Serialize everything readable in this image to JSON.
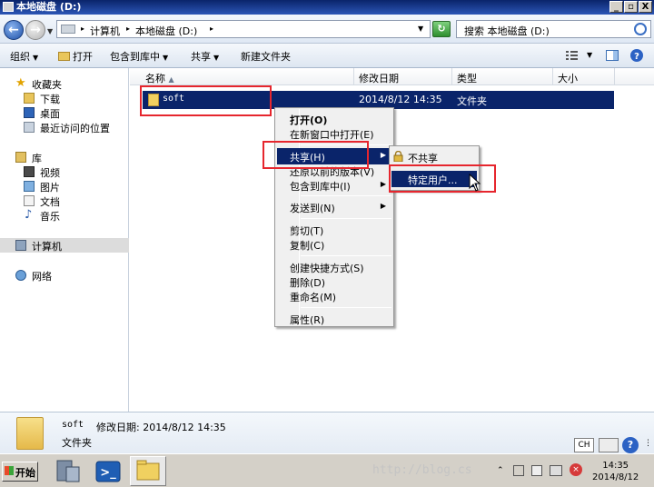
{
  "window": {
    "title": "本地磁盘 (D:)",
    "min_glyph": "_",
    "max_glyph": "▫",
    "close_glyph": "X"
  },
  "address": {
    "crumbs": [
      "计算机",
      "本地磁盘 (D:)"
    ],
    "search_placeholder": "搜索 本地磁盘 (D:)"
  },
  "toolbar": {
    "organize": "组织",
    "open": "打开",
    "include": "包含到库中",
    "share": "共享",
    "new_folder": "新建文件夹"
  },
  "nav": {
    "favorites": "收藏夹",
    "downloads": "下载",
    "desktop": "桌面",
    "recent": "最近访问的位置",
    "libraries": "库",
    "videos": "视频",
    "pictures": "图片",
    "documents": "文档",
    "music": "音乐",
    "computer": "计算机",
    "network": "网络"
  },
  "columns": {
    "name": "名称",
    "modified": "修改日期",
    "type": "类型",
    "size": "大小"
  },
  "files": [
    {
      "name": "soft",
      "modified": "2014/8/12 14:35",
      "type": "文件夹",
      "size": ""
    }
  ],
  "context_menu": {
    "open": "打开(O)",
    "open_new_window": "在新窗口中打开(E)",
    "share": "共享(H)",
    "restore": "还原以前的版本(V)",
    "include": "包含到库中(I)",
    "send_to": "发送到(N)",
    "cut": "剪切(T)",
    "copy": "复制(C)",
    "shortcut": "创建快捷方式(S)",
    "delete": "删除(D)",
    "rename": "重命名(M)",
    "properties": "属性(R)"
  },
  "share_submenu": {
    "no_share": "不共享",
    "specific_users": "特定用户..."
  },
  "details": {
    "name": "soft",
    "modified": "修改日期: 2014/8/12 14:35",
    "type": "文件夹"
  },
  "taskbar": {
    "start": "开始",
    "ime": "CH",
    "watermark": "http://blog.cs",
    "time": "14:35",
    "date": "2014/8/12"
  },
  "colors": {
    "title_bar": "#0a246a",
    "selection": "#0a246a",
    "highlight_box": "#e6262e"
  }
}
